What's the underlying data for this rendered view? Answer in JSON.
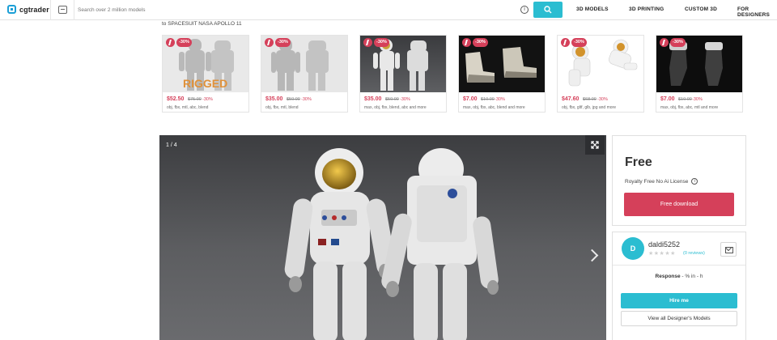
{
  "header": {
    "logo_text": "cgtrader",
    "search_placeholder": "Search over 2 million models",
    "nav": [
      "3D MODELS",
      "3D PRINTING",
      "CUSTOM 3D",
      "FOR DESIGNERS"
    ]
  },
  "breadcrumb": "to SPACESUIT NASA APOLLO 11",
  "related": [
    {
      "discount": "-30%",
      "price": "$52.50",
      "old_price": "$75.00",
      "formats": "obj, fbx, mtl, abc, blend",
      "overlay": "RIGGED"
    },
    {
      "discount": "-30%",
      "price": "$35.00",
      "old_price": "$50.00",
      "formats": "obj, fbx, mtl, blend"
    },
    {
      "discount": "-30%",
      "price": "$35.00",
      "old_price": "$50.00",
      "formats": "max, obj, fbx, blend, abc and more"
    },
    {
      "discount": "-30%",
      "price": "$7.00",
      "old_price": "$10.00",
      "formats": "max, obj, fbx, abc, blend and more"
    },
    {
      "discount": "-30%",
      "price": "$47.60",
      "old_price": "$68.00",
      "formats": "obj, fbx, gltf, glb, jpg and more"
    },
    {
      "discount": "-30%",
      "price": "$7.00",
      "old_price": "$10.00",
      "formats": "max, obj, fbx, abc, mtl and more"
    }
  ],
  "viewer": {
    "counter": "1 / 4"
  },
  "purchase": {
    "price": "Free",
    "license": "Royalty Free No Ai License",
    "download_label": "Free download"
  },
  "designer": {
    "avatar_letter": "D",
    "name": "daldi5252",
    "stars": "★★★★★",
    "reviews": "(0 reviews)",
    "response_label": "Response",
    "response_value": " - % in - h",
    "hire_label": "Hire me",
    "view_all_label": "View all Designer's Models"
  },
  "colors": {
    "accent": "#2bbdd1",
    "sale": "#d5405a"
  }
}
